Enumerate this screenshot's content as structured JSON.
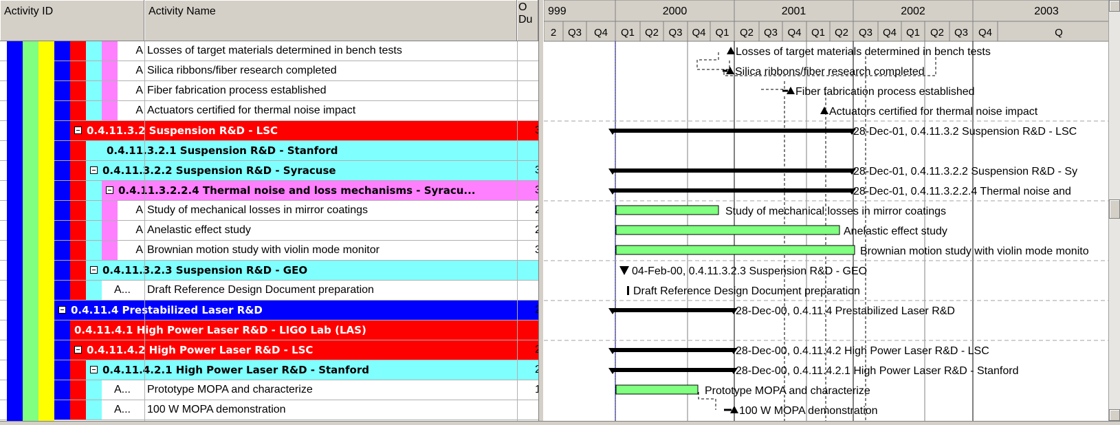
{
  "columns": {
    "activity_id": "Activity ID",
    "activity_name": "Activity Name",
    "orig_dur_top": "O",
    "orig_dur_bottom": "Du"
  },
  "timeline": {
    "years": [
      "999",
      "2000",
      "2001",
      "2002",
      "2003"
    ],
    "quarters": [
      "2",
      "Q3",
      "Q4",
      "Q1",
      "Q2",
      "Q3",
      "Q4",
      "Q1",
      "Q2",
      "Q3",
      "Q4",
      "Q1",
      "Q2",
      "Q3",
      "Q4",
      "Q1",
      "Q2",
      "Q3",
      "Q4",
      "Q"
    ]
  },
  "colors": {
    "level1": "#0000ff",
    "level2": "#80ff80",
    "level3": "#ffff00",
    "level4": "#0000ff",
    "level5": "#ff0000",
    "level6": "#80ffff",
    "level7": "#ff80ff",
    "bar": "#80ff80",
    "summary_bar": "#000000"
  },
  "rows": [
    {
      "id": "A",
      "name": "Losses of target materials determined in bench tests",
      "dur": "",
      "kind": "milestone",
      "level": 8,
      "gantt_label": "Losses of target materials determined in bench tests"
    },
    {
      "id": "A",
      "name": "Silica ribbons/fiber research completed",
      "dur": "",
      "kind": "milestone",
      "level": 8,
      "gantt_label": "Silica ribbons/fiber research completed"
    },
    {
      "id": "A",
      "name": "Fiber fabrication process established",
      "dur": "",
      "kind": "milestone",
      "level": 8,
      "gantt_label": "Fiber fabrication process established"
    },
    {
      "id": "A",
      "name": "Actuators certified for thermal noise impact",
      "dur": "",
      "kind": "milestone",
      "level": 8,
      "gantt_label": "Actuators certified for thermal noise impact"
    },
    {
      "id": "",
      "name": "0.4.11.3.2  Suspension R&D - LSC",
      "dur": "3",
      "kind": "group",
      "level": 5,
      "expander": true,
      "gantt_label": "28-Dec-01, 0.4.11.3.2  Suspension R&D - LSC"
    },
    {
      "id": "",
      "name": "0.4.11.3.2.1  Suspension R&D - Stanford",
      "dur": "",
      "kind": "group",
      "level": 6,
      "expander": false,
      "gantt_label": ""
    },
    {
      "id": "",
      "name": "0.4.11.3.2.2  Suspension R&D - Syracuse",
      "dur": "3",
      "kind": "group",
      "level": 6,
      "expander": true,
      "gantt_label": "28-Dec-01, 0.4.11.3.2.2  Suspension R&D - Sy"
    },
    {
      "id": "",
      "name": "0.4.11.3.2.2.4  Thermal noise and loss mechanisms - Syracu...",
      "dur": "3",
      "kind": "group",
      "level": 7,
      "expander": true,
      "gantt_label": "28-Dec-01, 0.4.11.3.2.2.4  Thermal noise and"
    },
    {
      "id": "A",
      "name": "Study of mechanical losses in mirror coatings",
      "dur": "2",
      "kind": "task",
      "level": 8,
      "gantt_label": "Study of mechanical losses in mirror coatings"
    },
    {
      "id": "A",
      "name": "Anelastic effect study",
      "dur": "2",
      "kind": "task",
      "level": 8,
      "gantt_label": "Anelastic effect study"
    },
    {
      "id": "A",
      "name": "Brownian motion study with violin mode monitor",
      "dur": "3",
      "kind": "task",
      "level": 8,
      "gantt_label": "Brownian motion study with violin mode monito"
    },
    {
      "id": "",
      "name": "0.4.11.3.2.3  Suspension R&D - GEO",
      "dur": "",
      "kind": "group",
      "level": 6,
      "expander": true,
      "gantt_label": "04-Feb-00, 0.4.11.3.2.3  Suspension R&D - GEO"
    },
    {
      "id": "A...",
      "name": "Draft Reference Design Document preparation",
      "dur": "",
      "kind": "task",
      "level": 7,
      "gantt_label": "Draft Reference Design Document preparation"
    },
    {
      "id": "",
      "name": "0.4.11.4  Prestabilized Laser R&D",
      "dur": "2",
      "kind": "group",
      "level": 4,
      "expander": true,
      "gantt_label": "28-Dec-00, 0.4.11.4  Prestabilized Laser R&D"
    },
    {
      "id": "",
      "name": "0.4.11.4.1  High Power Laser R&D - LIGO Lab (LAS)",
      "dur": "",
      "kind": "group",
      "level": 5,
      "expander": false,
      "gantt_label": ""
    },
    {
      "id": "",
      "name": "0.4.11.4.2  High Power Laser R&D - LSC",
      "dur": "2",
      "kind": "group",
      "level": 5,
      "expander": true,
      "gantt_label": "28-Dec-00, 0.4.11.4.2  High Power Laser R&D - LSC"
    },
    {
      "id": "",
      "name": "0.4.11.4.2.1  High Power Laser R&D - Stanford",
      "dur": "2",
      "kind": "group",
      "level": 6,
      "expander": true,
      "gantt_label": "28-Dec-00, 0.4.11.4.2.1  High Power Laser R&D - Stanford"
    },
    {
      "id": "A...",
      "name": "Prototype MOPA and characterize",
      "dur": "1",
      "kind": "task",
      "level": 7,
      "gantt_label": "Prototype MOPA and characterize"
    },
    {
      "id": "A...",
      "name": "100 W MOPA demonstration",
      "dur": "",
      "kind": "milestone",
      "level": 7,
      "gantt_label": "100 W MOPA demonstration"
    }
  ]
}
